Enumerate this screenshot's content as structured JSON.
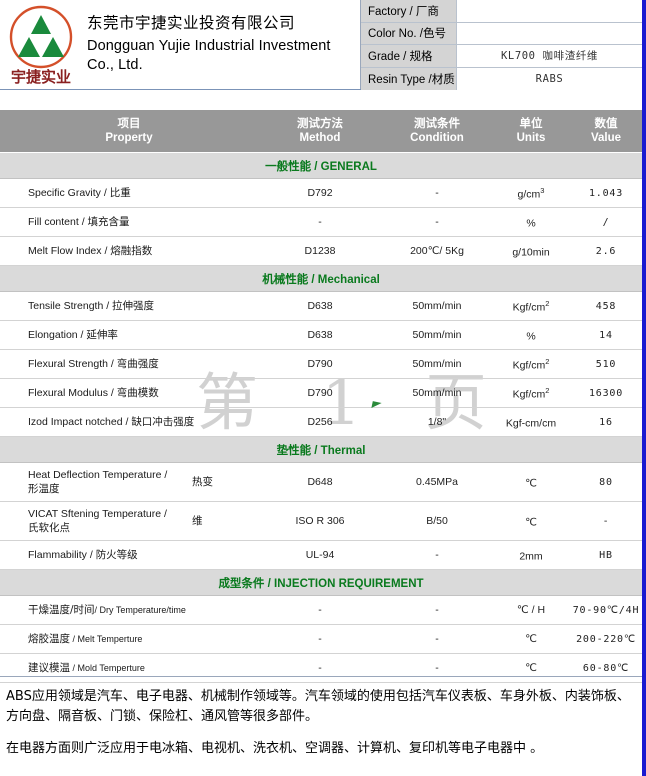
{
  "company": {
    "logo_text": "宇捷实业",
    "name_cn": "东莞市宇捷实业投资有限公司",
    "name_en": "Dongguan Yujie Industrial Investment Co., Ltd."
  },
  "info": {
    "rows": [
      {
        "label": "Factory / 厂商",
        "value": ""
      },
      {
        "label": "Color No. /色号",
        "value": ""
      },
      {
        "label": "Grade / 规格",
        "value": "KL700  咖啡渣纤维"
      },
      {
        "label": "Resin Type /材质",
        "value": "RABS"
      }
    ]
  },
  "table": {
    "headers": [
      {
        "cn": "项目",
        "en": "Property"
      },
      {
        "cn": "测试方法",
        "en": "Method"
      },
      {
        "cn": "测试条件",
        "en": "Condition"
      },
      {
        "cn": "单位",
        "en": "Units"
      },
      {
        "cn": "数值",
        "en": "Value"
      }
    ],
    "sections": [
      {
        "cn": "一般性,",
        "title_cn": "一般性能",
        "title_en": "GENERAL",
        "rows": [
          {
            "property_en": "Specific Gravity / ",
            "property_cn": "比重",
            "method": "D792",
            "condition": "-",
            "units": "g/cm",
            "units_sup": "3",
            "value": "1.043"
          },
          {
            "property_en": "Fill content / ",
            "property_cn": "填充含量",
            "method": "-",
            "condition": "-",
            "units": "%",
            "units_sup": "",
            "value": "/"
          },
          {
            "property_en": "Melt Flow Index / ",
            "property_cn": "熔融指数",
            "method": "D1238",
            "condition": "200℃/ 5Kg",
            "units": "g/10min",
            "units_sup": "",
            "value": "2.6"
          }
        ]
      },
      {
        "title_cn": "机械性能",
        "title_en": "Mechanical",
        "rows": [
          {
            "property_en": "Tensile Strength / ",
            "property_cn": "拉伸强度",
            "method": "D638",
            "condition": "50mm/min",
            "units": "Kgf/cm",
            "units_sup": "2",
            "value": "458"
          },
          {
            "property_en": "Elongation / ",
            "property_cn": "延伸率",
            "method": "D638",
            "condition": "50mm/min",
            "units": "%",
            "units_sup": "",
            "value": "14"
          },
          {
            "property_en": "Flexural Strength / ",
            "property_cn": "弯曲强度",
            "method": "D790",
            "condition": "50mm/min",
            "units": "Kgf/cm",
            "units_sup": "2",
            "value": "510"
          },
          {
            "property_en": "Flexural Modulus / ",
            "property_cn": "弯曲模数",
            "method": "D790",
            "condition": "50mm/min",
            "units": "Kgf/cm",
            "units_sup": "2",
            "value": "16300"
          },
          {
            "property_en": "Izod Impact notched / ",
            "property_cn": "缺口冲击强度",
            "method": "D256",
            "condition": "1/8\"",
            "units": "Kgf-cm/cm",
            "units_sup": "",
            "value": "16"
          }
        ]
      },
      {
        "title_cn": "垫性能",
        "title_en": "Thermal",
        "rows": [
          {
            "property_en": "Heat Deflection Temperature /",
            "property_cn": "形温度",
            "property_side": "热变",
            "method": "D648",
            "condition": "0.45MPa",
            "units": "℃",
            "units_sup": "",
            "value": "80"
          },
          {
            "property_en": "VICAT Sftening Temperature /",
            "property_cn": "氏软化点",
            "property_side": "维",
            "method": "ISO R 306",
            "condition": "B/50",
            "units": "℃",
            "units_sup": "",
            "value": "-"
          },
          {
            "property_en": "Flammability / ",
            "property_cn": "防火等级",
            "method": "UL-94",
            "condition": "-",
            "units": "2mm",
            "units_sup": "",
            "value": "HB"
          }
        ]
      },
      {
        "title_cn": "成型条件",
        "title_en": "INJECTION REQUIREMENT",
        "rows": [
          {
            "property_cn": "干燥温度/时间",
            "property_en_small": "/ Dry Temperature/time",
            "method": "-",
            "condition": "-",
            "units": "℃ / H",
            "units_sup": "",
            "value": "70-90℃/4H"
          },
          {
            "property_cn": "熔胶温度",
            "property_en_small": " / Melt Temperture",
            "method": "-",
            "condition": "-",
            "units": "℃",
            "units_sup": "",
            "value": "200-220℃"
          },
          {
            "property_cn": "建议模温",
            "property_en_small": " / Mold Temperture",
            "method": "-",
            "condition": "-",
            "units": "℃",
            "units_sup": "",
            "value": "60-80℃"
          }
        ]
      }
    ]
  },
  "watermark": {
    "text": "第 1 页"
  },
  "footer": {
    "paragraph1": "ABS应用领域是汽车、电子电器、机械制作领域等。汽车领域的使用包括汽车仪表板、车身外板、内装饰板、方向盘、隔音板、门锁、保险杠、通风管等很多部件。",
    "paragraph2": "在电器方面则广泛应用于电冰箱、电视机、洗衣机、空调器、计算机、复印机等电子电器中 。"
  },
  "colors": {
    "header_bar": "#989898",
    "section_band": "#dadada",
    "section_text": "#0a7a1e",
    "logo_circle": "#d4502a",
    "logo_triangle": "#1a8a3c",
    "logo_text": "#8a2020",
    "frame_blue": "#1a1ad0"
  }
}
